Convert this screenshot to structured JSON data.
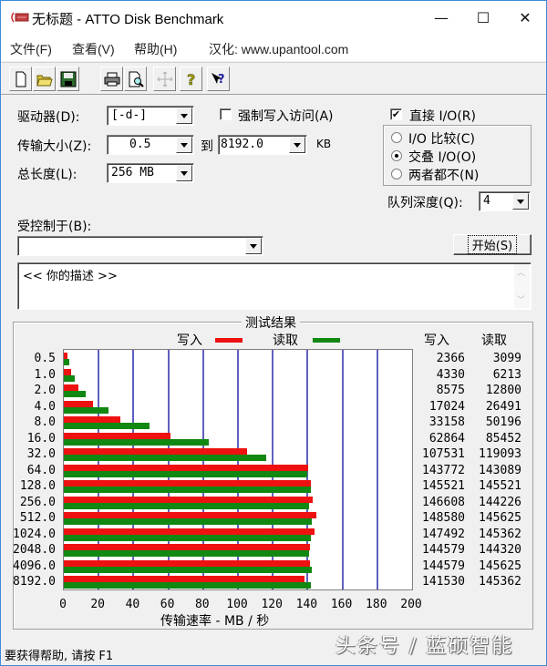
{
  "window": {
    "title": "无标题 - ATTO Disk Benchmark",
    "minimize_glyph": "—",
    "maximize_glyph": "☐",
    "close_glyph": "✕"
  },
  "menu": {
    "items": [
      {
        "label": "文件(F)"
      },
      {
        "label": "查看(V)"
      },
      {
        "label": "帮助(H)"
      },
      {
        "label": "汉化: www.upantool.com"
      }
    ]
  },
  "toolbar": {
    "buttons": [
      {
        "icon": "new-document-icon"
      },
      {
        "icon": "open-folder-icon"
      },
      {
        "icon": "save-disk-icon"
      },
      {
        "icon": "print-icon"
      },
      {
        "icon": "print-preview-icon"
      },
      {
        "icon": "move-arrows-icon",
        "disabled": true
      },
      {
        "icon": "help-icon"
      },
      {
        "icon": "context-help-icon"
      }
    ]
  },
  "settings": {
    "drive_label": "驱动器(D):",
    "drive_value": "[-d-]",
    "transfer_size_label": "传输大小(Z):",
    "transfer_from": "0.5",
    "to_label": "到",
    "transfer_to": "8192.0",
    "unit_label": "KB",
    "total_length_label": "总长度(L):",
    "total_length_value": "256 MB",
    "force_write_label": "强制写入访问(A)",
    "force_write_checked": false,
    "direct_io_label": "直接 I/O(R)",
    "direct_io_checked": true,
    "io_compare_label": "I/O 比较(C)",
    "overlapped_io_label": "交叠 I/O(O)",
    "neither_label": "两者都不(N)",
    "selected_mode": "overlapped",
    "queue_depth_label": "队列深度(Q):",
    "queue_depth_value": "4",
    "controlled_by_label": "受控制于(B):",
    "controlled_by_value": "",
    "start_button": "开始(S)",
    "description": "<<   你的描述     >>"
  },
  "results": {
    "group_title": "测试结果",
    "legend_write": "写入",
    "legend_read": "读取",
    "col_write": "写入",
    "col_read": "读取",
    "write_color": "#ee1111",
    "read_color": "#118811"
  },
  "chart_data": {
    "type": "bar",
    "orientation": "horizontal",
    "title": "测试结果",
    "xlabel": "传输速率 - MB / 秒",
    "ylabel": "",
    "xlim": [
      0,
      200
    ],
    "xticks": [
      "0",
      "20",
      "40",
      "60",
      "80",
      "100",
      "120",
      "140",
      "160",
      "180",
      "200"
    ],
    "grid": true,
    "legend": "top-center",
    "categories": [
      "0.5",
      "1.0",
      "2.0",
      "4.0",
      "8.0",
      "16.0",
      "32.0",
      "64.0",
      "128.0",
      "256.0",
      "512.0",
      "1024.0",
      "2048.0",
      "4096.0",
      "8192.0"
    ],
    "series": [
      {
        "name": "写入",
        "values_kb_per_s": [
          2366,
          4330,
          8575,
          17024,
          33158,
          62864,
          107531,
          143772,
          145521,
          146608,
          148580,
          147492,
          144579,
          144579,
          141530
        ]
      },
      {
        "name": "读取",
        "values_kb_per_s": [
          3099,
          6213,
          12800,
          26491,
          50196,
          85452,
          119093,
          143089,
          145521,
          144226,
          145625,
          145362,
          144320,
          145625,
          145362
        ]
      }
    ]
  },
  "status": {
    "text": "要获得帮助, 请按 F1"
  },
  "watermark": "头条号 / 蓝硕智能"
}
